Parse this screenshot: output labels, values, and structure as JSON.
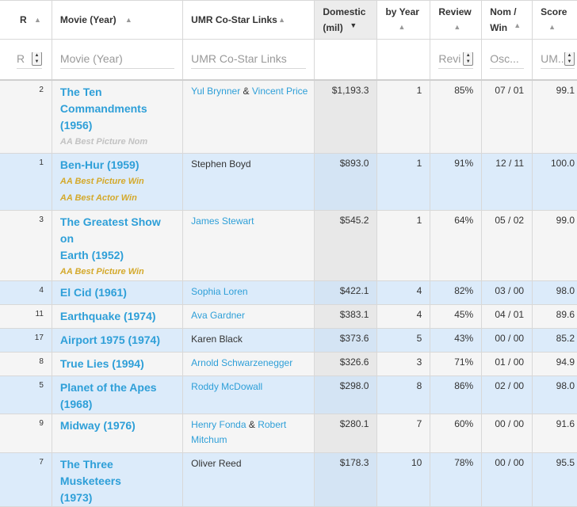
{
  "columns": [
    {
      "id": "r",
      "label_lines": [
        "R"
      ],
      "placeholder": "R"
    },
    {
      "id": "movie",
      "label_lines": [
        "Movie (Year)"
      ],
      "placeholder": "Movie (Year)"
    },
    {
      "id": "costar",
      "label_lines": [
        "UMR Co-Star Links"
      ],
      "placeholder": "UMR Co-Star Links"
    },
    {
      "id": "domestic",
      "label_lines": [
        "Domestic",
        "(mil)"
      ],
      "placeholder": ""
    },
    {
      "id": "byyear",
      "label_lines": [
        "by Year"
      ],
      "placeholder": ""
    },
    {
      "id": "review",
      "label_lines": [
        "Review"
      ],
      "placeholder": "Revi"
    },
    {
      "id": "nomwin",
      "label_lines": [
        "Nom /",
        "Win"
      ],
      "placeholder": "Osc..."
    },
    {
      "id": "score",
      "label_lines": [
        "Score"
      ],
      "placeholder": "UM..."
    }
  ],
  "rows": [
    {
      "rank": "2",
      "title_lines": [
        "The Ten",
        "Commandments",
        "(1956)"
      ],
      "awards": [
        {
          "text": "AA Best Picture Nom",
          "type": "nom"
        }
      ],
      "costars": [
        {
          "text": "Yul Brynner",
          "link": true
        },
        {
          "text": " & ",
          "link": false
        },
        {
          "text": "Vincent Price",
          "link": true
        }
      ],
      "domestic": "$1,193.3",
      "byyear": "1",
      "review": "85%",
      "nomwin": "07 / 01",
      "score": "99.1",
      "style": "alt"
    },
    {
      "rank": "1",
      "title_lines": [
        "Ben-Hur (1959)"
      ],
      "awards": [
        {
          "text": "AA Best Picture Win",
          "type": "win"
        },
        {
          "text": "AA Best Actor Win",
          "type": "win"
        }
      ],
      "costars": [
        {
          "text": "Stephen Boyd",
          "link": false
        }
      ],
      "domestic": "$893.0",
      "byyear": "1",
      "review": "91%",
      "nomwin": "12 / 11",
      "score": "100.0",
      "style": "hi"
    },
    {
      "rank": "3",
      "title_lines": [
        "The Greatest Show on",
        "Earth (1952)"
      ],
      "awards": [
        {
          "text": "AA Best Picture Win",
          "type": "win"
        }
      ],
      "costars": [
        {
          "text": "James Stewart",
          "link": true
        }
      ],
      "domestic": "$545.2",
      "byyear": "1",
      "review": "64%",
      "nomwin": "05 / 02",
      "score": "99.0",
      "style": "alt"
    },
    {
      "rank": "4",
      "title_lines": [
        "El Cid (1961)"
      ],
      "awards": [],
      "costars": [
        {
          "text": "Sophia Loren",
          "link": true
        }
      ],
      "domestic": "$422.1",
      "byyear": "4",
      "review": "82%",
      "nomwin": "03 / 00",
      "score": "98.0",
      "style": "hi"
    },
    {
      "rank": "11",
      "title_lines": [
        "Earthquake (1974)"
      ],
      "awards": [],
      "costars": [
        {
          "text": "Ava Gardner",
          "link": true
        }
      ],
      "domestic": "$383.1",
      "byyear": "4",
      "review": "45%",
      "nomwin": "04 / 01",
      "score": "89.6",
      "style": "alt"
    },
    {
      "rank": "17",
      "title_lines": [
        "Airport 1975 (1974)"
      ],
      "awards": [],
      "costars": [
        {
          "text": "Karen Black",
          "link": false
        }
      ],
      "domestic": "$373.6",
      "byyear": "5",
      "review": "43%",
      "nomwin": "00 / 00",
      "score": "85.2",
      "style": "hi"
    },
    {
      "rank": "8",
      "title_lines": [
        "True Lies (1994)"
      ],
      "awards": [],
      "costars": [
        {
          "text": "Arnold Schwarzenegger",
          "link": true
        }
      ],
      "domestic": "$326.6",
      "byyear": "3",
      "review": "71%",
      "nomwin": "01 / 00",
      "score": "94.9",
      "style": "alt"
    },
    {
      "rank": "5",
      "title_lines": [
        "Planet of the Apes",
        "(1968)"
      ],
      "awards": [],
      "costars": [
        {
          "text": "Roddy McDowall",
          "link": true
        }
      ],
      "domestic": "$298.0",
      "byyear": "8",
      "review": "86%",
      "nomwin": "02 / 00",
      "score": "98.0",
      "style": "hi"
    },
    {
      "rank": "9",
      "title_lines": [
        "Midway (1976)"
      ],
      "awards": [],
      "costars": [
        {
          "text": "Henry Fonda",
          "link": true
        },
        {
          "text": " & ",
          "link": false
        },
        {
          "text": "Robert Mitchum",
          "link": true
        }
      ],
      "domestic": "$280.1",
      "byyear": "7",
      "review": "60%",
      "nomwin": "00 / 00",
      "score": "91.6",
      "style": "alt"
    },
    {
      "rank": "7",
      "title_lines": [
        "The Three Musketeers",
        "(1973)"
      ],
      "awards": [],
      "costars": [
        {
          "text": "Oliver Reed",
          "link": false
        }
      ],
      "domestic": "$178.3",
      "byyear": "10",
      "review": "78%",
      "nomwin": "00 / 00",
      "score": "95.5",
      "style": "hi"
    }
  ],
  "icons": {
    "sort_asc": "caret-up-icon",
    "sort_desc": "caret-down-icon",
    "spinner": "number-spinner-icon"
  },
  "colors": {
    "link": "#2e9fd8",
    "win": "#d4a92b",
    "nom": "#c2c2c2",
    "highlight_row": "#dcebfa",
    "alt_row": "#f5f5f5"
  }
}
